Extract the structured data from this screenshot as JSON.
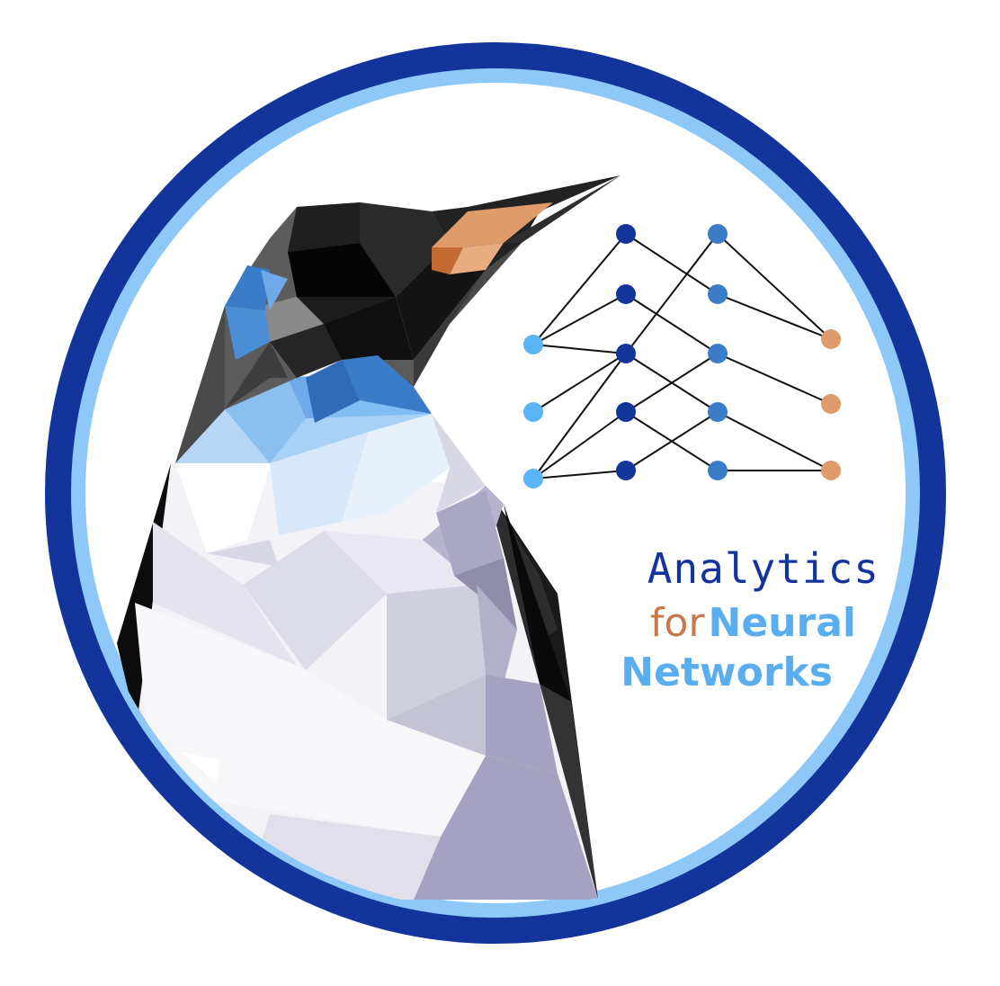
{
  "logo": {
    "line1": "Analytics",
    "line2_part1": "for",
    "line2_part2": "Neural",
    "line3": "Networks"
  },
  "colors": {
    "ring_outer": "#13349a",
    "ring_inner": "#8ec8f8",
    "background": "#ffffff",
    "text_dark_blue": "#13349a",
    "text_orange": "#c47a4b",
    "text_light_blue": "#5aaef0",
    "node_input": "#5ab4f5",
    "node_hidden1": "#13349a",
    "node_hidden2": "#3a7cc8",
    "node_output": "#e09b6b",
    "penguin_black": "#111111",
    "penguin_beak": "#e09b6b",
    "penguin_blue": "#3a7cc8",
    "penguin_white": "#f3f3f7",
    "penguin_lavender": "#a4a2c0"
  },
  "icons": {
    "mascot": "penguin-lowpoly-icon",
    "network": "neural-network-icon"
  }
}
